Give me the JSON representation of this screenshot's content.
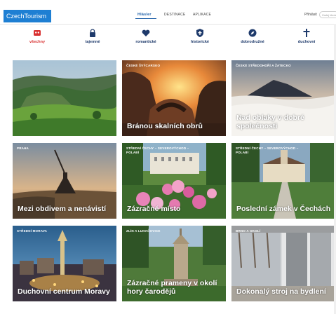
{
  "header": {
    "logo": "CzechTourism",
    "nav": [
      {
        "label": "Hlásler",
        "active": true
      },
      {
        "label": "DESTINACE",
        "active": false
      },
      {
        "label": "APLIKACE",
        "active": false
      }
    ],
    "login": "Přihlásit",
    "search_placeholder": "Zadej hledat"
  },
  "categories": [
    {
      "label": "všechny",
      "icon": "hearts-icon",
      "active": true
    },
    {
      "label": "tajemné",
      "icon": "lock-icon",
      "active": false
    },
    {
      "label": "romantické",
      "icon": "heart-icon",
      "active": false
    },
    {
      "label": "historické",
      "icon": "shield-cross-icon",
      "active": false
    },
    {
      "label": "dobrodružné",
      "icon": "compass-icon",
      "active": false
    },
    {
      "label": "duchovní",
      "icon": "cross-icon",
      "active": false
    }
  ],
  "tiles": [
    {
      "region": "",
      "title": ""
    },
    {
      "region": "České Švýcarsko",
      "title": "Bránou skalních obrů"
    },
    {
      "region": "České Středohoří a Žatecko",
      "title": "Nad oblaky v dobré společnosti"
    },
    {
      "region": "Praha",
      "title": "Mezi obdivem a nenávistí"
    },
    {
      "region": "Střední Čechy – Severovýchod – Polabí",
      "title": "Zázračné místo"
    },
    {
      "region": "Střední Čechy – Severovýchod – Polabí",
      "title": "Poslední zámek v Čechách"
    },
    {
      "region": "Střední Morava",
      "title": "Duchovní centrum Moravy"
    },
    {
      "region": "Zlín a Luhačovice",
      "title": "Zázračné prameny v okolí hory čarodějů"
    },
    {
      "region": "Brno a okolí",
      "title": "Dokonalý stroj na bydlení"
    }
  ]
}
